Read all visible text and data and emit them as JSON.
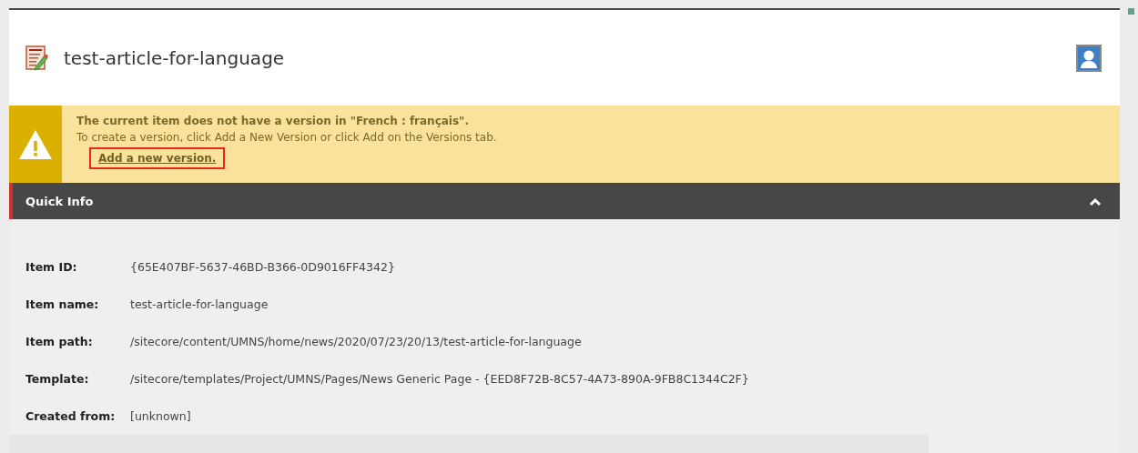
{
  "header": {
    "title": "test-article-for-language"
  },
  "notice": {
    "heading": "The current item does not have a version in \"French : français\".",
    "text": "To create a version, click Add a New Version or click Add on the Versions tab.",
    "link": {
      "label": "Add a new version.",
      "highlighted": true
    }
  },
  "section": {
    "title": "Quick Info",
    "expanded": true
  },
  "fields": [
    {
      "label": "Item ID:",
      "value": "{65E407BF-5637-46BD-B366-0D9016FF4342}"
    },
    {
      "label": "Item name:",
      "value": "test-article-for-language"
    },
    {
      "label": "Item path:",
      "value": "/sitecore/content/UMNS/home/news/2020/07/23/20/13/test-article-for-language"
    },
    {
      "label": "Template:",
      "value": "/sitecore/templates/Project/UMNS/Pages/News Generic Page - {EED8F72B-8C57-4A73-890A-9FB8C1344C2F}"
    },
    {
      "label": "Created from:",
      "value": "[unknown]"
    }
  ]
}
